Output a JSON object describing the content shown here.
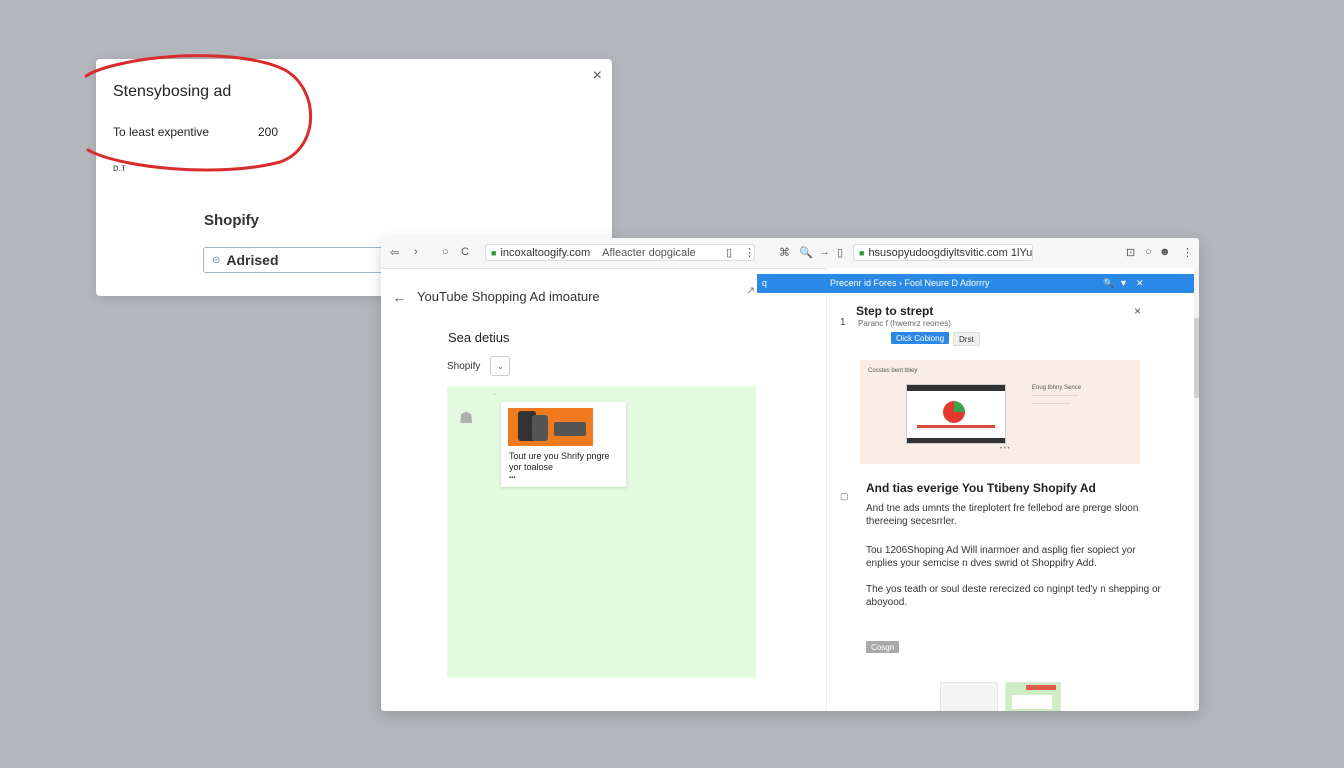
{
  "dialog": {
    "title": "Stensybosing ad",
    "row_label": "To least expentive",
    "row_value": "200",
    "stub": "ᴅ.ᴛ",
    "section_label": "Shopify",
    "field_value": "Adrised",
    "close_glyph": "×",
    "field_icon_glyph": "⊝"
  },
  "annotation": {
    "color": "#d92c2c"
  },
  "browser": {
    "left_url": "incoxaltoogify.com",
    "left_tab_text": "Afleacter dopgicale",
    "right_url": "hsusopyudoogdiyltsvitic.com 1lYu",
    "icons": {
      "back": "⇦",
      "forward": "›",
      "reload": "C",
      "stop": "○",
      "menu": "⋮",
      "share": "⌘",
      "search": "🔍",
      "arrow_right": "→",
      "bookmark": "▯",
      "zoom": "⊡",
      "profile": "☻"
    }
  },
  "left_pane": {
    "back_glyph": "←",
    "page_title": "YouTube Shopping Ad imoature",
    "ext_glyph": "↗",
    "section_heading": "Sea detius",
    "select_value": "Shopify",
    "select_chevron": "⌄",
    "card_caption": "Tout ure you Shrify pngre yor toalose",
    "card_dot": "▪▪▪",
    "green_icon": "☗",
    "green_dot": "▫"
  },
  "right_pane": {
    "bluebar_text": "Precenr id Fores  ›  Fool Neure D Adorrry",
    "bluebar_icons": [
      "🔍",
      "▼",
      "✕"
    ],
    "bluebar_left_icon": "q",
    "step_number": "1",
    "step_title": "Step to strept",
    "step_subtitle": "Paranc f (hwemrz reorres)",
    "step_close": "×",
    "blue_button": "Oick Cobiong",
    "grey_button": "Drst",
    "preview_caption": "Cosstes bent tbley",
    "preview_side_text": "Eoug tbhny Sence\n·······················\n···················",
    "preview_dots": "• • •",
    "hero_bullet": "▢",
    "hero_title": "And tias everige You Ttibeny Shopify Ad",
    "paragraph1": "And tne ads umnts the tireplotert fre fellebod are prerge sloon thereeing secesrrler.",
    "paragraph2": "Tou 1206Shoping Ad Will inarmoer and asplig fier sopiect yor enplies your semcise n dves swrid ot Shoppifry Add.",
    "paragraph3": "The yos teath or soul deste rerecized co nginpt ted'y n shepping or aboyood.",
    "small_button": "Cosgn"
  }
}
